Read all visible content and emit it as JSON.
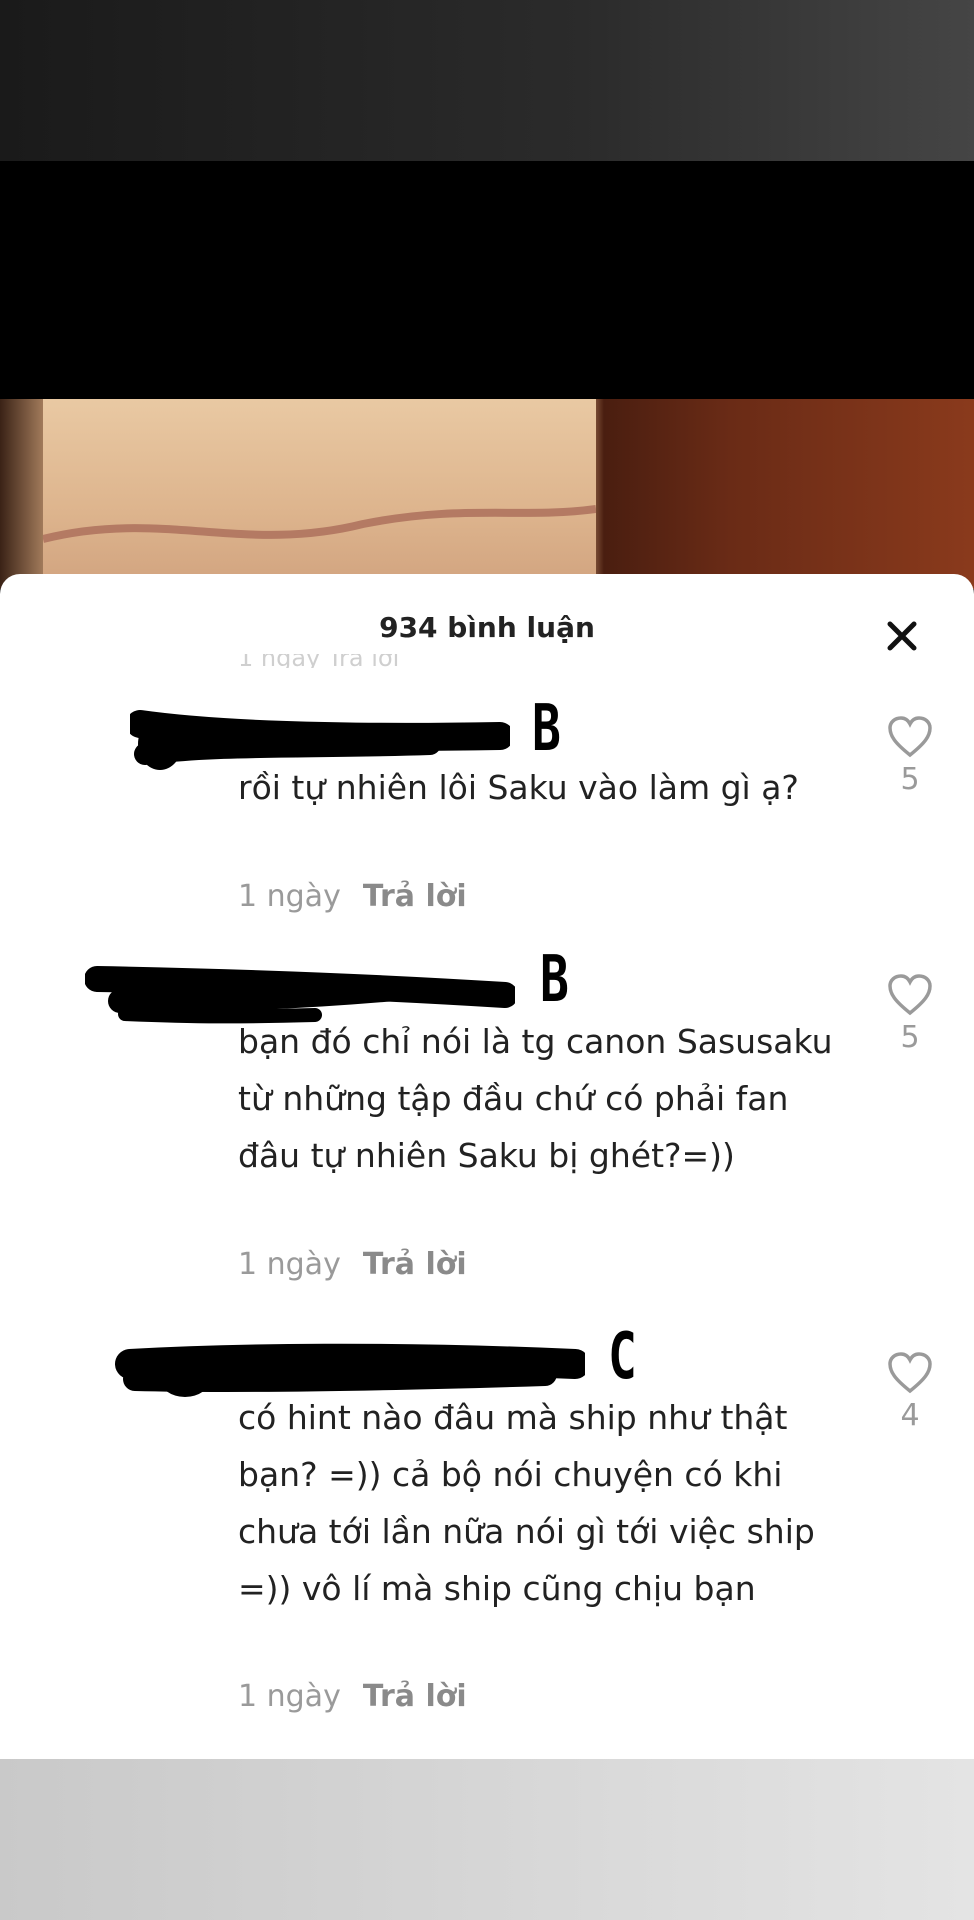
{
  "header": {
    "comment_count": "934 bình luận"
  },
  "partial_prev_meta": "1 ngày  Trả lời",
  "comments": [
    {
      "letter": "B",
      "text": "rồi tự nhiên lôi Saku vào làm gì ạ?",
      "time": "1 ngày",
      "reply": "Trả lời",
      "likes": "5"
    },
    {
      "letter": "B",
      "text": "bạn đó chỉ nói là tg canon Sasusaku từ những tập đầu chứ có phải fan đâu tự nhiên Saku bị ghét?=))",
      "time": "1 ngày",
      "reply": "Trả lời",
      "likes": "5"
    },
    {
      "letter": "C",
      "text": "có hint nào đâu mà ship như thật bạn? =)) cả bộ nói chuyện có khi chưa tới lần nữa nói gì tới việc ship =)) vô lí mà ship cũng chịu bạn",
      "time": "1 ngày",
      "reply": "Trả lời",
      "likes": "4"
    }
  ],
  "icons": {
    "close": "close-icon",
    "like": "heart-outline-icon"
  }
}
